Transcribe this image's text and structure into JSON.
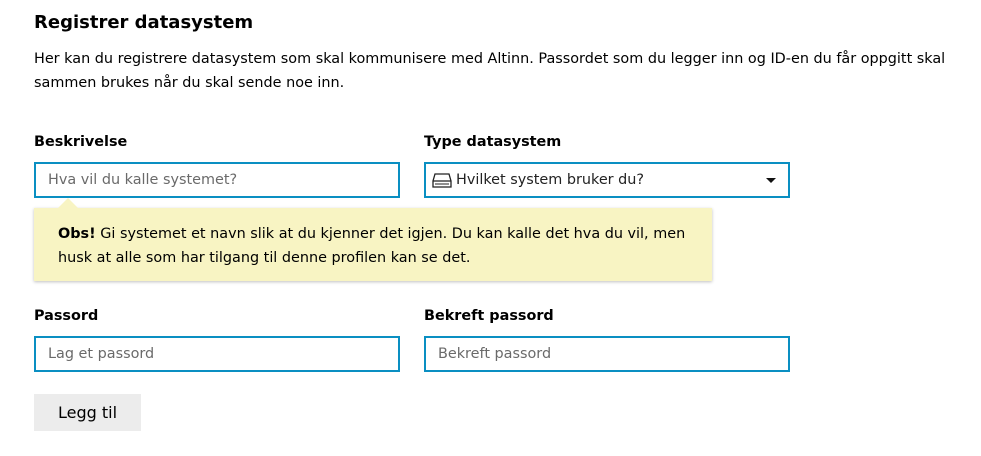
{
  "page": {
    "title": "Registrer datasystem",
    "intro": "Her kan du registrere datasystem som skal kommunisere med Altinn. Passordet som du legger inn og ID-en du får oppgitt skal sammen brukes når du skal sende noe inn."
  },
  "form": {
    "description": {
      "label": "Beskrivelse",
      "placeholder": "Hva vil du kalle systemet?"
    },
    "system_type": {
      "label": "Type datasystem",
      "selected": "Hvilket system bruker du?",
      "icon": "server-icon"
    },
    "notice": {
      "strong": "Obs!",
      "text": " Gi systemet et navn slik at du kjenner det igjen. Du kan kalle det hva du vil, men husk at alle som har tilgang til denne profilen kan se det."
    },
    "password": {
      "label": "Passord",
      "placeholder": "Lag et passord"
    },
    "confirm_password": {
      "label": "Bekreft passord",
      "placeholder": "Bekreft passord"
    },
    "submit_label": "Legg til"
  },
  "colors": {
    "focus_border": "#0a8fc2",
    "notice_bg": "#f8f4c3",
    "button_bg": "#ececec"
  }
}
